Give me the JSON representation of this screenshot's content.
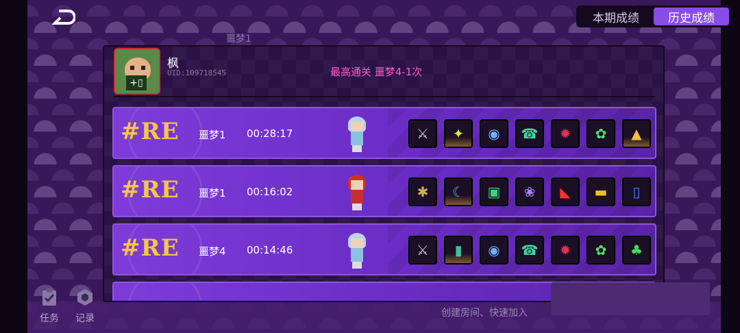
{
  "tabs": [
    {
      "label": "本期成绩",
      "active": false
    },
    {
      "label": "历史成绩",
      "active": true
    }
  ],
  "background_label": "噩梦1",
  "profile": {
    "name": "枫",
    "uid": "UID:109718545",
    "best": "最高通关  噩梦4-1次"
  },
  "records": [
    {
      "rank": "#RE",
      "stage": "噩梦1",
      "time": "00:28:17",
      "hero": "hero-silver-hair",
      "items": [
        "sword-icon",
        "leaf-gem-icon",
        "eye-orb-icon",
        "telephone-icon",
        "demon-mask-icon",
        "green-blob-icon",
        "triangle-gem-icon"
      ]
    },
    {
      "rank": "#RE",
      "stage": "噩梦1",
      "time": "00:16:02",
      "hero": "hero-red-hat",
      "items": [
        "spider-icon",
        "moon-slash-icon",
        "tome-icon",
        "lotus-icon",
        "red-blade-icon",
        "yellow-car-icon",
        "game-console-icon"
      ]
    },
    {
      "rank": "#RE",
      "stage": "噩梦4",
      "time": "00:14:46",
      "hero": "hero-silver-hair",
      "items": [
        "sword-icon",
        "green-card-icon",
        "eye-orb-icon",
        "telephone-icon",
        "demon-mask-icon",
        "green-blob-icon",
        "cactus-icon"
      ]
    }
  ],
  "sidebar": {
    "task_label": "任务",
    "record_label": "记录"
  },
  "bottom": {
    "hint": "创建房间、快速加入"
  },
  "colors": {
    "accent": "#8a4ce6",
    "rank_gold": "#f3c64a",
    "best_pink": "#ff5ac8",
    "row_purple": "#7e3bd8"
  }
}
